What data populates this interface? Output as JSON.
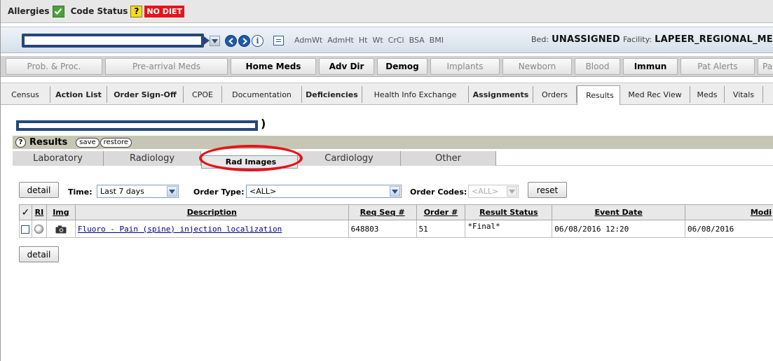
{
  "banner": {
    "allergies_label": "Allergies",
    "code_status_label": "Code Status",
    "code_status_value": "?",
    "diet_badge": "NO DIET"
  },
  "patient_bar": {
    "measures": [
      "AdmWt",
      "AdmHt",
      "Ht",
      "Wt",
      "CrCl",
      "BSA",
      "BMI"
    ],
    "bed_label": "Bed:",
    "bed_value": "UNASSIGNED",
    "facility_label": "Facility:",
    "facility_value": "LAPEER_REGIONAL_ME"
  },
  "button_row": [
    {
      "label": "Prob. & Proc.",
      "active": false
    },
    {
      "label": "Pre-arrival Meds",
      "active": false
    },
    {
      "label": "Home Meds",
      "active": true
    },
    {
      "label": "Adv Dir",
      "active": true
    },
    {
      "label": "Demog",
      "active": true
    },
    {
      "label": "Implants",
      "active": false
    },
    {
      "label": "Newborn",
      "active": false
    },
    {
      "label": "Blood",
      "active": false
    },
    {
      "label": "Immun",
      "active": true
    },
    {
      "label": "Pat Alerts",
      "active": false
    },
    {
      "label": "Pa",
      "active": false
    }
  ],
  "tabs": [
    {
      "label": "Census"
    },
    {
      "label": "Action List"
    },
    {
      "label": "Order Sign-Off"
    },
    {
      "label": "CPOE"
    },
    {
      "label": "Documentation"
    },
    {
      "label": "Deficiencies"
    },
    {
      "label": "Health Info Exchange"
    },
    {
      "label": "Assignments"
    },
    {
      "label": "Orders"
    },
    {
      "label": "Results"
    },
    {
      "label": "Med Rec View"
    },
    {
      "label": "Meds"
    },
    {
      "label": "Vitals"
    }
  ],
  "results": {
    "title": "Results",
    "help": "?",
    "save": "save",
    "restore": "restore",
    "paren": ")",
    "subtabs": [
      "Laboratory",
      "Radiology",
      "Rad Images",
      "Cardiology",
      "Other"
    ],
    "selected_subtab": "Rad Images"
  },
  "filters": {
    "detail_label": "detail",
    "time_label": "Time:",
    "time_value": "Last 7 days",
    "order_type_label": "Order Type:",
    "order_type_value": "<ALL>",
    "order_codes_label": "Order Codes:",
    "order_codes_value": "<ALL>",
    "reset_label": "reset"
  },
  "table": {
    "headers": {
      "check": "✓",
      "ri": "RI",
      "img": "Img",
      "description": "Description",
      "req_seq": "Req Seq #",
      "order_no": "Order #",
      "result_status": "Result Status",
      "event_date": "Event Date",
      "modified": "Modi"
    },
    "rows": [
      {
        "description": "Fluoro - Pain (spine) injection localization",
        "req_seq": "648803",
        "order_no": "51",
        "result_status": "*Final*",
        "event_date": "06/08/2016 12:20",
        "modified": "06/08/2016"
      }
    ]
  },
  "colors": {
    "allergies_check": "#4aa23a",
    "code_status": "#f5dc1e",
    "no_diet": "#e8141b",
    "redaction_border": "#24467b",
    "highlight_circle": "#e4141b",
    "results_header": "#c6c6b4"
  }
}
